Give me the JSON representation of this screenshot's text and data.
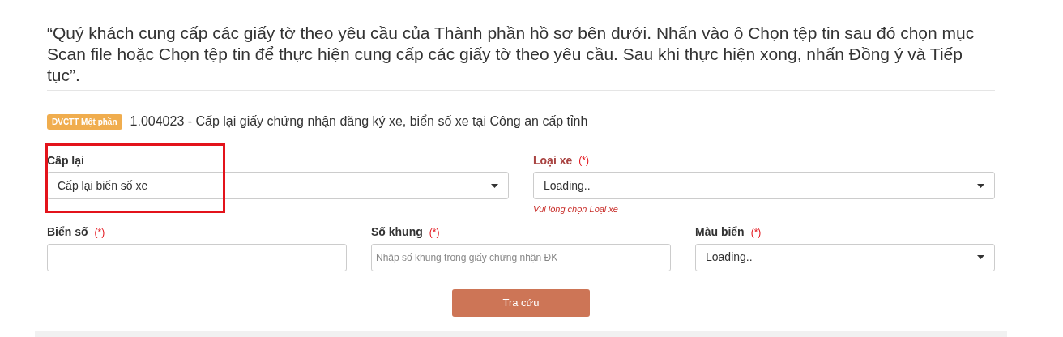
{
  "instructions": "“Quý khách cung cấp các giấy tờ theo yêu cầu của Thành phần hồ sơ bên dưới. Nhấn vào ô Chọn tệp tin sau đó chọn mục Scan file hoặc Chọn tệp tin để thực hiện cung cấp các giấy tờ theo yêu cầu. Sau khi thực hiện xong, nhấn Đồng ý và Tiếp tục”.",
  "procedure": {
    "badge": "DVCTT Một phần",
    "title": "1.004023 - Cấp lại giấy chứng nhận đăng ký xe, biển số xe tại Công an cấp tỉnh"
  },
  "form_rows": [
    {
      "fields": [
        {
          "kind": "select",
          "label": "Cấp lại",
          "value": "Cấp lại biển số xe",
          "invalid": false,
          "highlighted": true
        },
        {
          "kind": "select",
          "label": "Loại xe",
          "required_mark": "(*)",
          "value": "Loading..",
          "invalid": true,
          "error": "Vui lòng chọn Loại xe",
          "highlighted": false
        }
      ]
    },
    {
      "fields": [
        {
          "kind": "input",
          "label": "Biển số",
          "required_mark": "(*)",
          "invalid": false,
          "highlighted": false
        },
        {
          "kind": "input",
          "label": "Số khung",
          "required_mark": "(*)",
          "placeholder": "Nhập số khung trong giấy chứng nhận ĐK",
          "invalid": false,
          "highlighted": false
        },
        {
          "kind": "select",
          "label": "Màu biển",
          "required_mark": "(*)",
          "value": "Loading..",
          "invalid": false,
          "highlighted": false
        }
      ]
    }
  ],
  "search_button": "Tra cứu"
}
